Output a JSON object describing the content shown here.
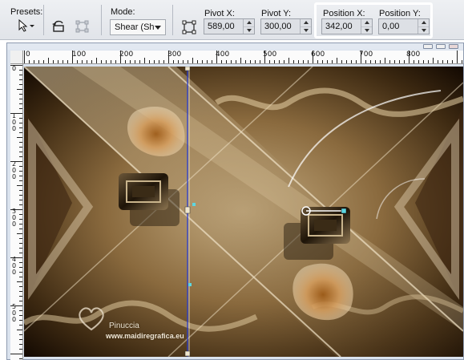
{
  "toolbar": {
    "presets_label": "Presets:",
    "mode_label": "Mode:",
    "mode_value": "Shear (Sh",
    "pivot_x_label": "Pivot X:",
    "pivot_x_value": "589,00",
    "pivot_y_label": "Pivot Y:",
    "pivot_y_value": "300,00",
    "position_x_label": "Position X:",
    "position_x_value": "342,00",
    "position_y_label": "Position Y:",
    "position_y_value": "0,00"
  },
  "ruler": {
    "h_labels": [
      "0",
      "100",
      "200",
      "300",
      "400",
      "500",
      "600",
      "700",
      "800"
    ],
    "v_labels": [
      "0",
      "100",
      "200",
      "300",
      "400",
      "500"
    ]
  },
  "canvas": {
    "watermark_name": "Pinuccia",
    "watermark_url": "www.maidiregrafica.eu"
  },
  "colors": {
    "highlight": "#ffffff",
    "accent_blue": "#2a3fd6",
    "artwork_dark": "#2a1a08",
    "artwork_light": "#d8c29a"
  },
  "icons": {
    "preset": "pick-arrow-icon",
    "reset": "undo-rect-icon",
    "lock": "rect-corners-icon",
    "mode_arrow": "chevron-down-icon",
    "deform": "deform-box-icon"
  }
}
